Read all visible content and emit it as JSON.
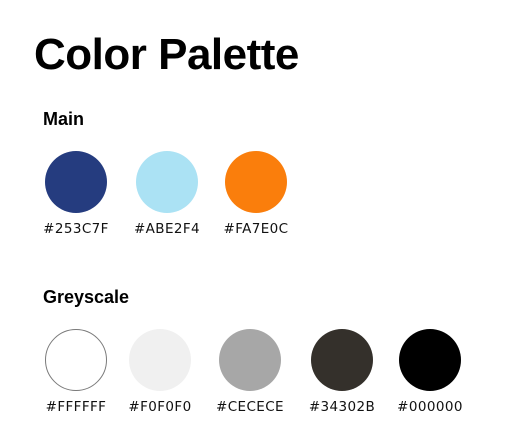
{
  "title": "Color Palette",
  "sections": {
    "main": {
      "heading": "Main",
      "colors": [
        {
          "hex": "#253C7F",
          "fill": "#253C7F"
        },
        {
          "hex": "#ABE2F4",
          "fill": "#ABE2F4"
        },
        {
          "hex": "#FA7E0C",
          "fill": "#FA7E0C"
        }
      ]
    },
    "greyscale": {
      "heading": "Greyscale",
      "colors": [
        {
          "hex": "#FFFFFF",
          "fill": "#FFFFFF"
        },
        {
          "hex": "#F0F0F0",
          "fill": "#F0F0F0"
        },
        {
          "hex": "#CECECE",
          "fill": "#A7A7A7"
        },
        {
          "hex": "#34302B",
          "fill": "#34302B"
        },
        {
          "hex": "#000000",
          "fill": "#000000"
        }
      ]
    }
  }
}
